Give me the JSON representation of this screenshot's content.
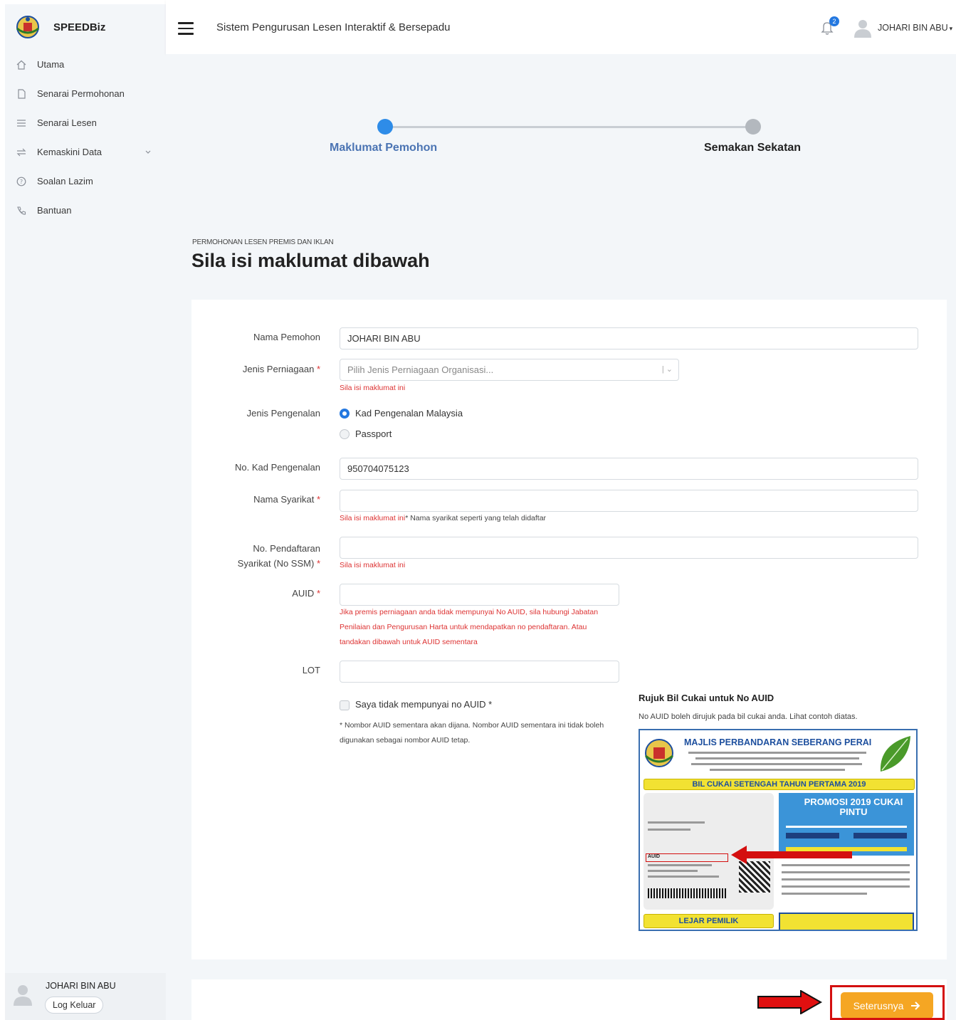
{
  "app": {
    "name": "SPEEDBiz",
    "subtitle": "Sistem Pengurusan Lesen Interaktif & Bersepadu"
  },
  "user": {
    "name": "JOHARI BIN ABU",
    "notifications": "2",
    "logout": "Log Keluar"
  },
  "sidebar": {
    "items": [
      {
        "label": "Utama",
        "icon": "home-icon"
      },
      {
        "label": "Senarai Permohonan",
        "icon": "file-icon"
      },
      {
        "label": "Senarai Lesen",
        "icon": "list-icon"
      },
      {
        "label": "Kemaskini Data",
        "icon": "refresh-icon"
      },
      {
        "label": "Soalan Lazim",
        "icon": "help-icon"
      },
      {
        "label": "Bantuan",
        "icon": "phone-icon"
      }
    ]
  },
  "stepper": {
    "step1": "Maklumat Pemohon",
    "step2": "Semakan Sekatan"
  },
  "page": {
    "subtitle": "PERMOHONAN LESEN PREMIS DAN IKLAN",
    "title": "Sila isi maklumat dibawah"
  },
  "form": {
    "nama_pemohon": {
      "label": "Nama Pemohon",
      "value": "JOHARI BIN ABU"
    },
    "jenis_perniagaan": {
      "label": "Jenis Perniagaan",
      "placeholder": "Pilih Jenis Perniagaan Organisasi...",
      "error": "Sila isi maklumat ini"
    },
    "jenis_pengenalan": {
      "label": "Jenis Pengenalan",
      "opt1": "Kad Pengenalan Malaysia",
      "opt2": "Passport"
    },
    "no_kp": {
      "label": "No. Kad Pengenalan",
      "value": "950704075123"
    },
    "nama_syarikat": {
      "label": "Nama Syarikat",
      "error": "Sila isi maklumat ini",
      "hint": "* Nama syarikat seperti yang telah didaftar"
    },
    "no_ssm": {
      "label_line1": "No. Pendaftaran",
      "label_line2": "Syarikat (No SSM)",
      "error": "Sila isi maklumat ini"
    },
    "auid": {
      "label": "AUID",
      "hint_line1": "Jika premis perniagaan anda tidak mempunyai No AUID, sila hubungi Jabatan",
      "hint_line2": "Penilaian dan Pengurusan Harta untuk mendapatkan no pendaftaran. Atau",
      "hint_line3": "tandakan dibawah untuk AUID sementara"
    },
    "lot": {
      "label": "LOT"
    },
    "no_auid_checkbox": {
      "label": "Saya tidak mempunyai no AUID",
      "note_line1": "* Nombor AUID sementara akan dijana. Nombor AUID sementara ini tidak boleh",
      "note_line2": "digunakan sebagai nombor AUID tetap."
    },
    "required_mark": "*"
  },
  "reference": {
    "title": "Rujuk Bil Cukai untuk No AUID",
    "desc": "No AUID boleh dirujuk pada bil cukai anda. Lihat contoh diatas.",
    "bill_title": "MAJLIS PERBANDARAN SEBERANG PERAI",
    "bill_band": "BIL CUKAI SETENGAH TAHUN PERTAMA 2019",
    "bill_promo": "PROMOSI 2019 CUKAI PINTU",
    "bill_ledger": "LEJAR PEMILIK",
    "bill_auid": "AUID"
  },
  "actions": {
    "next": "Seterusnya"
  },
  "colors": {
    "primary": "#2e8ce8",
    "next_button": "#f5a623",
    "error": "#d33333",
    "highlight": "#d40f0f"
  }
}
